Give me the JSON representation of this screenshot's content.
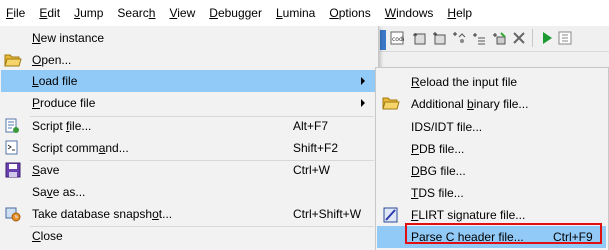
{
  "menubar": {
    "items": [
      {
        "label": "File",
        "ul": "F",
        "rest": "ile"
      },
      {
        "label": "Edit",
        "ul": "E",
        "rest": "dit"
      },
      {
        "label": "Jump",
        "ul": "J",
        "rest": "ump"
      },
      {
        "label": "Search",
        "pre": "Searc",
        "ul": "h",
        "rest": ""
      },
      {
        "label": "View",
        "ul": "V",
        "rest": "iew"
      },
      {
        "label": "Debugger",
        "ul": "D",
        "rest": "ebugger"
      },
      {
        "label": "Lumina",
        "ul": "L",
        "rest": "umina"
      },
      {
        "label": "Options",
        "ul": "O",
        "rest": "ptions"
      },
      {
        "label": "Windows",
        "ul": "W",
        "rest": "indows"
      },
      {
        "label": "Help",
        "ul": "H",
        "rest": "elp"
      }
    ]
  },
  "file_menu": {
    "new_instance": {
      "ul": "N",
      "rest": "ew instance"
    },
    "open": {
      "ul": "O",
      "rest": "pen..."
    },
    "load_file": {
      "ul": "L",
      "rest": "oad file"
    },
    "produce_file": {
      "ul": "P",
      "rest": "roduce file"
    },
    "script_file": {
      "pre": "Script ",
      "ul": "f",
      "rest": "ile...",
      "shortcut": "Alt+F7"
    },
    "script_command": {
      "pre": "Script comm",
      "ul": "a",
      "rest": "nd...",
      "shortcut": "Shift+F2"
    },
    "save": {
      "ul": "S",
      "rest": "ave",
      "shortcut": "Ctrl+W"
    },
    "save_as": {
      "pre": "Sa",
      "ul": "v",
      "rest": "e as..."
    },
    "take_snapshot": {
      "pre": "Take database snapsh",
      "ul": "o",
      "rest": "t...",
      "shortcut": "Ctrl+Shift+W"
    },
    "close": {
      "ul": "C",
      "rest": "lose"
    }
  },
  "load_submenu": {
    "reload": {
      "ul": "R",
      "rest": "eload the input file"
    },
    "additional_binary": {
      "pre": "Additional ",
      "ul": "b",
      "rest": "inary file..."
    },
    "ids_idt": {
      "pre": "IDS/IDT file...",
      "ul": "",
      "rest": ""
    },
    "pdb": {
      "ul": "P",
      "rest": "DB file..."
    },
    "dbg": {
      "ul": "D",
      "rest": "BG file..."
    },
    "tds": {
      "ul": "T",
      "rest": "DS file..."
    },
    "flirt": {
      "ul": "F",
      "rest": "LIRT signature file..."
    },
    "parse_c": {
      "pre": "Parse ",
      "ul": "C",
      "rest": " header file...",
      "shortcut": "Ctrl+F9"
    }
  }
}
